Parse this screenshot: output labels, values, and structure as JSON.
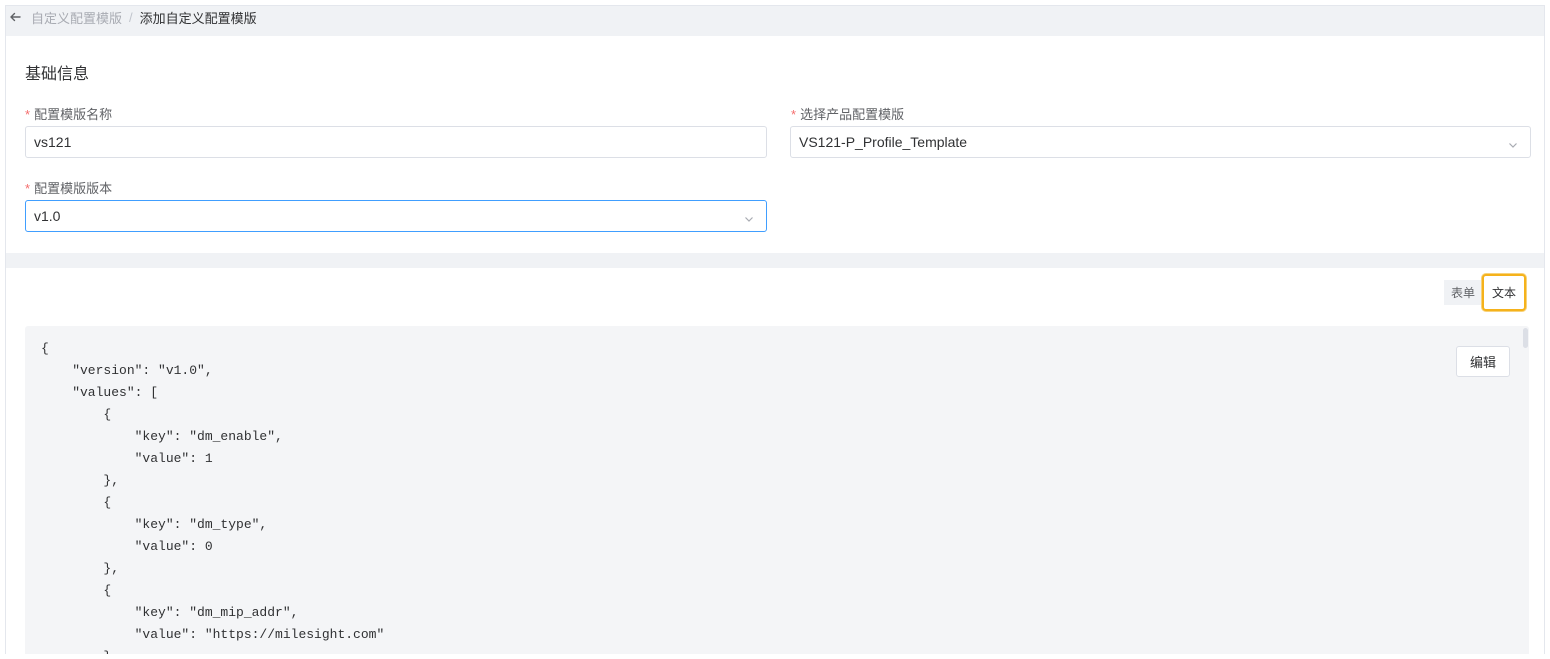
{
  "breadcrumb": {
    "back_icon": "arrow-left-icon",
    "parent": "自定义配置模版",
    "separator": "/",
    "current": "添加自定义配置模版"
  },
  "basic_info": {
    "title": "基础信息",
    "required_mark": "*",
    "name_label": "配置模版名称",
    "name_value": "vs121",
    "product_template_label": "选择产品配置模版",
    "product_template_value": "VS121-P_Profile_Template",
    "version_label": "配置模版版本",
    "version_value": "v1.0"
  },
  "view_toggle": {
    "form_label": "表单",
    "text_label": "文本",
    "active": "text",
    "highlight_color": "#f5b21b"
  },
  "editor": {
    "edit_label": "编辑",
    "lines": [
      "{",
      "    \"version\": \"v1.0\",",
      "    \"values\": [",
      "        {",
      "            \"key\": \"dm_enable\",",
      "            \"value\": 1",
      "        },",
      "        {",
      "            \"key\": \"dm_type\",",
      "            \"value\": 0",
      "        },",
      "        {",
      "            \"key\": \"dm_mip_addr\",",
      "            \"value\": \"https://milesight.com\"",
      "        },"
    ]
  },
  "colors": {
    "required": "#f56c6c",
    "focus_border": "#409eff",
    "page_bg": "#f0f2f5"
  }
}
